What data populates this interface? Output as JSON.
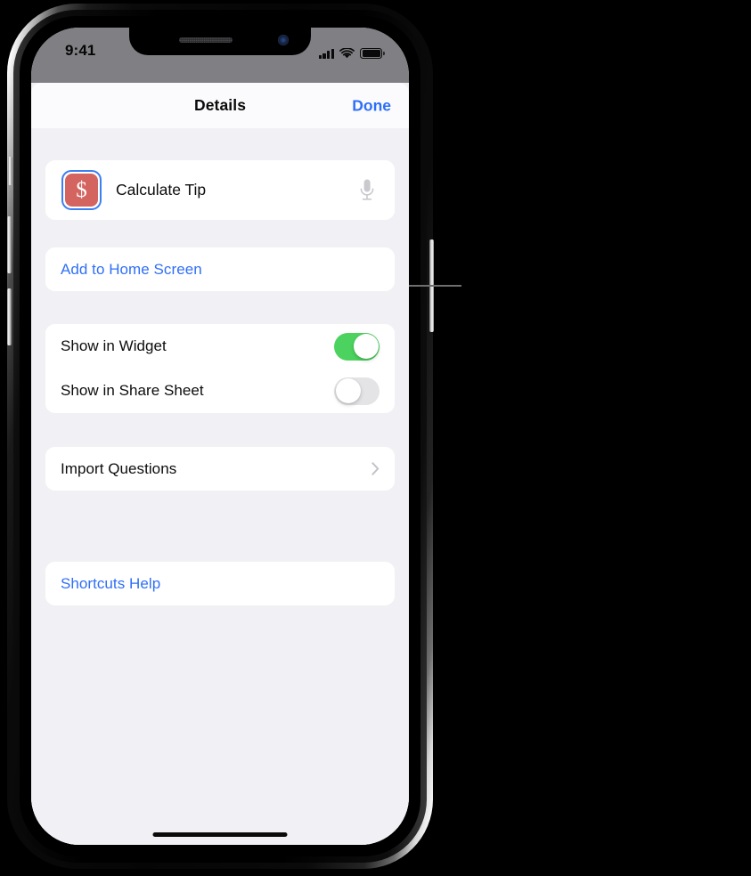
{
  "device": {
    "name": "iphone-x",
    "status_bar": {
      "time": "9:41",
      "icons": [
        "cellular-signal-icon",
        "wifi-icon",
        "battery-icon"
      ],
      "signal_bars": 4,
      "battery_full": true
    },
    "notch": {
      "speaker_grille": "speaker-icon",
      "front_camera": "camera-icon"
    },
    "side_buttons": [
      {
        "name": "silence-switch",
        "side": "left"
      },
      {
        "name": "volume-up-button",
        "side": "left"
      },
      {
        "name": "volume-down-button",
        "side": "left"
      },
      {
        "name": "power-button",
        "side": "right"
      }
    ],
    "home_indicator": true
  },
  "nav_bar": {
    "title": "Details",
    "done_label": "Done"
  },
  "shortcut": {
    "name": "Calculate Tip",
    "icon_glyph": "$",
    "icon_color": "#d4645f",
    "icon_selection_ring_color": "#3b7ff0",
    "mic_icon": "microphone-icon"
  },
  "sections": {
    "add_to_home": {
      "label": "Add to Home Screen"
    },
    "toggles": [
      {
        "label": "Show in Widget",
        "value": "on"
      },
      {
        "label": "Show in Share Sheet",
        "value": "off"
      }
    ],
    "import": {
      "label": "Import Questions",
      "accessory": "chevron-right-icon"
    },
    "help": {
      "label": "Shortcuts Help"
    }
  },
  "colors": {
    "link_blue": "#2f6ff7",
    "toggle_on_green": "#4cd35f",
    "toggle_off_gray": "#e4e4e6",
    "sheet_background": "#f1f1f5",
    "card_background": "#ffffff",
    "status_bar_gray": "#808084",
    "callout_line_gray": "#6e6e70"
  },
  "annotation": {
    "callout_leader_line": true,
    "points_to": "Add to Home Screen"
  }
}
